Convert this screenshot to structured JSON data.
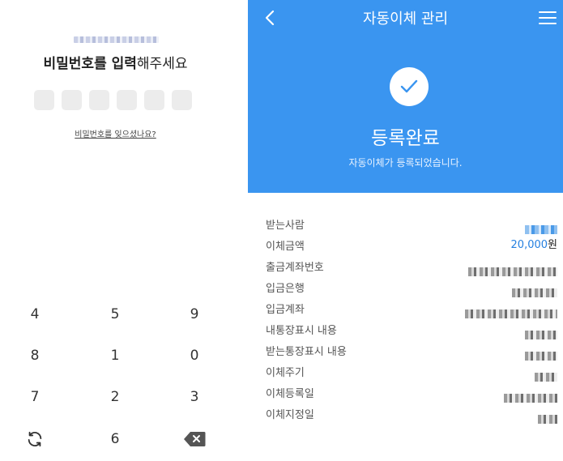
{
  "password_screen": {
    "title_bold": "비밀번호를 입력",
    "title_rest": "해주세요",
    "forgot_link": "비밀번호를 잊으셨나요?",
    "pin_length": 6,
    "keypad": {
      "row1": [
        "4",
        "5",
        "9"
      ],
      "row2": [
        "8",
        "1",
        "0"
      ],
      "row3": [
        "7",
        "2",
        "3"
      ],
      "row4_center": "6"
    }
  },
  "transfer_screen": {
    "header_title": "자동이체 관리",
    "done_title": "등록완료",
    "done_subtitle": "자동이체가 등록되었습니다.",
    "details": [
      {
        "label": "받는사람"
      },
      {
        "label": "이체금액",
        "value": "20,000",
        "unit": "원"
      },
      {
        "label": "출금계좌번호"
      },
      {
        "label": "입금은행"
      },
      {
        "label": "입금계좌"
      },
      {
        "label": "내통장표시 내용"
      },
      {
        "label": "받는통장표시 내용"
      },
      {
        "label": "이체주기"
      },
      {
        "label": "이체등록일"
      },
      {
        "label": "이체지정일"
      }
    ]
  },
  "colors": {
    "brand_blue": "#3a95f0",
    "amount_blue": "#2580e0",
    "pin_box": "#ececec"
  }
}
